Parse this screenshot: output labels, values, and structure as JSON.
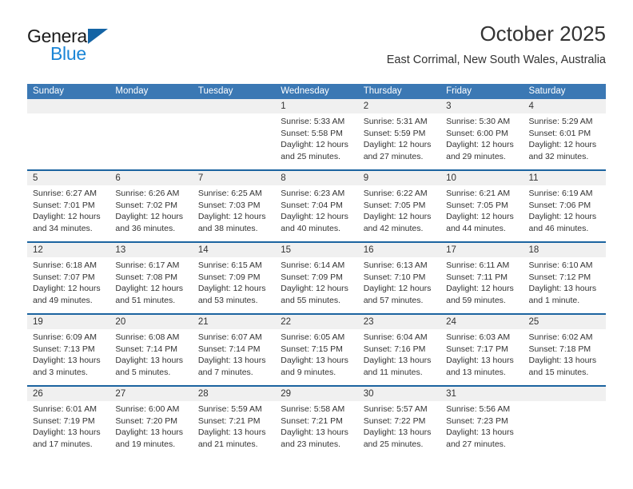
{
  "brand": {
    "name_part1": "General",
    "name_part2": "Blue",
    "triangle_color": "#1464a5",
    "blue_color": "#1a85d6"
  },
  "header": {
    "title": "October 2025",
    "subtitle": "East Corrimal, New South Wales, Australia"
  },
  "theme": {
    "header_blue": "#3b78b4",
    "row_separator_blue": "#1c64a0",
    "date_strip_gray": "#f0f0f0"
  },
  "weekdays": [
    "Sunday",
    "Monday",
    "Tuesday",
    "Wednesday",
    "Thursday",
    "Friday",
    "Saturday"
  ],
  "weeks": [
    [
      {
        "day": "",
        "lines": []
      },
      {
        "day": "",
        "lines": []
      },
      {
        "day": "",
        "lines": []
      },
      {
        "day": "1",
        "lines": [
          "Sunrise: 5:33 AM",
          "Sunset: 5:58 PM",
          "Daylight: 12 hours",
          "and 25 minutes."
        ]
      },
      {
        "day": "2",
        "lines": [
          "Sunrise: 5:31 AM",
          "Sunset: 5:59 PM",
          "Daylight: 12 hours",
          "and 27 minutes."
        ]
      },
      {
        "day": "3",
        "lines": [
          "Sunrise: 5:30 AM",
          "Sunset: 6:00 PM",
          "Daylight: 12 hours",
          "and 29 minutes."
        ]
      },
      {
        "day": "4",
        "lines": [
          "Sunrise: 5:29 AM",
          "Sunset: 6:01 PM",
          "Daylight: 12 hours",
          "and 32 minutes."
        ]
      }
    ],
    [
      {
        "day": "5",
        "lines": [
          "Sunrise: 6:27 AM",
          "Sunset: 7:01 PM",
          "Daylight: 12 hours",
          "and 34 minutes."
        ]
      },
      {
        "day": "6",
        "lines": [
          "Sunrise: 6:26 AM",
          "Sunset: 7:02 PM",
          "Daylight: 12 hours",
          "and 36 minutes."
        ]
      },
      {
        "day": "7",
        "lines": [
          "Sunrise: 6:25 AM",
          "Sunset: 7:03 PM",
          "Daylight: 12 hours",
          "and 38 minutes."
        ]
      },
      {
        "day": "8",
        "lines": [
          "Sunrise: 6:23 AM",
          "Sunset: 7:04 PM",
          "Daylight: 12 hours",
          "and 40 minutes."
        ]
      },
      {
        "day": "9",
        "lines": [
          "Sunrise: 6:22 AM",
          "Sunset: 7:05 PM",
          "Daylight: 12 hours",
          "and 42 minutes."
        ]
      },
      {
        "day": "10",
        "lines": [
          "Sunrise: 6:21 AM",
          "Sunset: 7:05 PM",
          "Daylight: 12 hours",
          "and 44 minutes."
        ]
      },
      {
        "day": "11",
        "lines": [
          "Sunrise: 6:19 AM",
          "Sunset: 7:06 PM",
          "Daylight: 12 hours",
          "and 46 minutes."
        ]
      }
    ],
    [
      {
        "day": "12",
        "lines": [
          "Sunrise: 6:18 AM",
          "Sunset: 7:07 PM",
          "Daylight: 12 hours",
          "and 49 minutes."
        ]
      },
      {
        "day": "13",
        "lines": [
          "Sunrise: 6:17 AM",
          "Sunset: 7:08 PM",
          "Daylight: 12 hours",
          "and 51 minutes."
        ]
      },
      {
        "day": "14",
        "lines": [
          "Sunrise: 6:15 AM",
          "Sunset: 7:09 PM",
          "Daylight: 12 hours",
          "and 53 minutes."
        ]
      },
      {
        "day": "15",
        "lines": [
          "Sunrise: 6:14 AM",
          "Sunset: 7:09 PM",
          "Daylight: 12 hours",
          "and 55 minutes."
        ]
      },
      {
        "day": "16",
        "lines": [
          "Sunrise: 6:13 AM",
          "Sunset: 7:10 PM",
          "Daylight: 12 hours",
          "and 57 minutes."
        ]
      },
      {
        "day": "17",
        "lines": [
          "Sunrise: 6:11 AM",
          "Sunset: 7:11 PM",
          "Daylight: 12 hours",
          "and 59 minutes."
        ]
      },
      {
        "day": "18",
        "lines": [
          "Sunrise: 6:10 AM",
          "Sunset: 7:12 PM",
          "Daylight: 13 hours",
          "and 1 minute."
        ]
      }
    ],
    [
      {
        "day": "19",
        "lines": [
          "Sunrise: 6:09 AM",
          "Sunset: 7:13 PM",
          "Daylight: 13 hours",
          "and 3 minutes."
        ]
      },
      {
        "day": "20",
        "lines": [
          "Sunrise: 6:08 AM",
          "Sunset: 7:14 PM",
          "Daylight: 13 hours",
          "and 5 minutes."
        ]
      },
      {
        "day": "21",
        "lines": [
          "Sunrise: 6:07 AM",
          "Sunset: 7:14 PM",
          "Daylight: 13 hours",
          "and 7 minutes."
        ]
      },
      {
        "day": "22",
        "lines": [
          "Sunrise: 6:05 AM",
          "Sunset: 7:15 PM",
          "Daylight: 13 hours",
          "and 9 minutes."
        ]
      },
      {
        "day": "23",
        "lines": [
          "Sunrise: 6:04 AM",
          "Sunset: 7:16 PM",
          "Daylight: 13 hours",
          "and 11 minutes."
        ]
      },
      {
        "day": "24",
        "lines": [
          "Sunrise: 6:03 AM",
          "Sunset: 7:17 PM",
          "Daylight: 13 hours",
          "and 13 minutes."
        ]
      },
      {
        "day": "25",
        "lines": [
          "Sunrise: 6:02 AM",
          "Sunset: 7:18 PM",
          "Daylight: 13 hours",
          "and 15 minutes."
        ]
      }
    ],
    [
      {
        "day": "26",
        "lines": [
          "Sunrise: 6:01 AM",
          "Sunset: 7:19 PM",
          "Daylight: 13 hours",
          "and 17 minutes."
        ]
      },
      {
        "day": "27",
        "lines": [
          "Sunrise: 6:00 AM",
          "Sunset: 7:20 PM",
          "Daylight: 13 hours",
          "and 19 minutes."
        ]
      },
      {
        "day": "28",
        "lines": [
          "Sunrise: 5:59 AM",
          "Sunset: 7:21 PM",
          "Daylight: 13 hours",
          "and 21 minutes."
        ]
      },
      {
        "day": "29",
        "lines": [
          "Sunrise: 5:58 AM",
          "Sunset: 7:21 PM",
          "Daylight: 13 hours",
          "and 23 minutes."
        ]
      },
      {
        "day": "30",
        "lines": [
          "Sunrise: 5:57 AM",
          "Sunset: 7:22 PM",
          "Daylight: 13 hours",
          "and 25 minutes."
        ]
      },
      {
        "day": "31",
        "lines": [
          "Sunrise: 5:56 AM",
          "Sunset: 7:23 PM",
          "Daylight: 13 hours",
          "and 27 minutes."
        ]
      },
      {
        "day": "",
        "lines": []
      }
    ]
  ]
}
